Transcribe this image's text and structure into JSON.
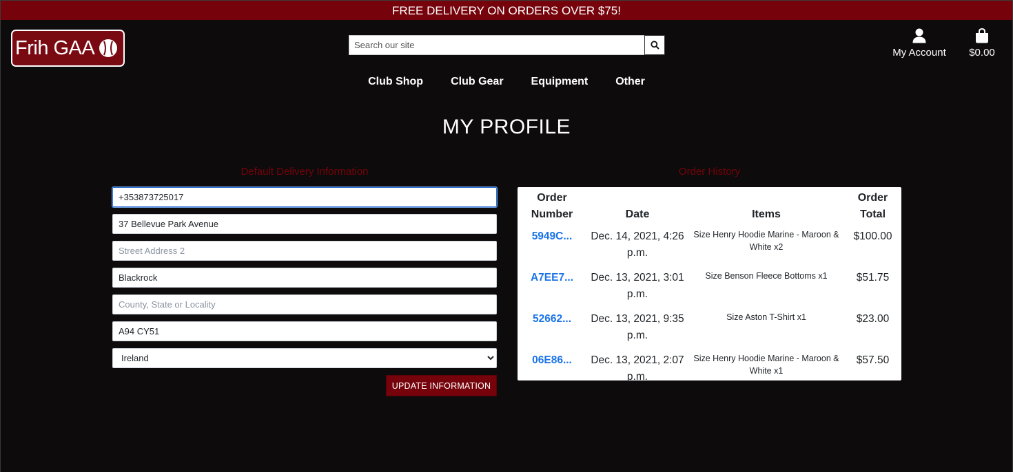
{
  "banner": {
    "text": "FREE DELIVERY ON ORDERS OVER $75!"
  },
  "logo": {
    "text": "Frih GAA",
    "icon": "sliotar-ball-icon"
  },
  "search": {
    "placeholder": "Search our site",
    "icon": "search-icon"
  },
  "header": {
    "account_label": "My Account",
    "account_icon": "user-icon",
    "cart_label": "$0.00",
    "cart_icon": "shopping-bag-icon"
  },
  "nav": {
    "items": [
      {
        "label": "Club Shop"
      },
      {
        "label": "Club Gear"
      },
      {
        "label": "Equipment"
      },
      {
        "label": "Other"
      }
    ]
  },
  "page": {
    "title": "MY PROFILE"
  },
  "delivery": {
    "heading": "Default Delivery Information",
    "phone": "+353873725017",
    "street1": "37 Bellevue Park Avenue",
    "street2_placeholder": "Street Address 2",
    "town": "Blackrock",
    "county_placeholder": "County, State or Locality",
    "postcode": "A94 CY51",
    "country": "Ireland",
    "update_label": "UPDATE INFORMATION"
  },
  "orders": {
    "heading": "Order History",
    "columns": {
      "number": "Order Number",
      "date": "Date",
      "items": "Items",
      "total": "Order Total"
    },
    "rows": [
      {
        "number": "5949C...",
        "date": "Dec. 14, 2021, 4:26 p.m.",
        "items": "Size Henry Hoodie Marine - Maroon & White x2",
        "total": "$100.00"
      },
      {
        "number": "A7EE7...",
        "date": "Dec. 13, 2021, 3:01 p.m.",
        "items": "Size Benson Fleece Bottoms x1",
        "total": "$51.75"
      },
      {
        "number": "52662...",
        "date": "Dec. 13, 2021, 9:35 p.m.",
        "items": "Size Aston T-Shirt x1",
        "total": "$23.00"
      },
      {
        "number": "06E86...",
        "date": "Dec. 13, 2021, 2:07 p.m.",
        "items": "Size Henry Hoodie Marine - Maroon & White x1",
        "total": "$57.50"
      }
    ]
  },
  "colors": {
    "brand_maroon": "#76030b",
    "background": "#0d0b0b",
    "link_blue": "#1a73e8"
  }
}
